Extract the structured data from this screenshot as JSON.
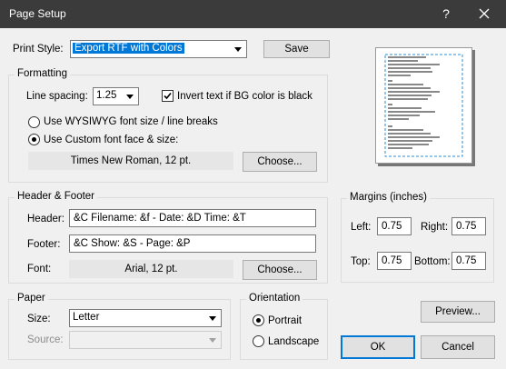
{
  "window": {
    "title": "Page Setup",
    "help_glyph": "?"
  },
  "print_style": {
    "label": "Print Style:",
    "value": "Export RTF with Colors",
    "save_label": "Save"
  },
  "formatting": {
    "legend": "Formatting",
    "line_spacing_label": "Line spacing:",
    "line_spacing_value": "1.25",
    "invert_label": "Invert text if BG color is black",
    "invert_checked": true,
    "wysiwyg_label": "Use WYSIWYG font size / line breaks",
    "custom_font_label": "Use Custom font face & size:",
    "font_value": "Times New Roman, 12 pt.",
    "choose_label": "Choose..."
  },
  "header_footer": {
    "legend": "Header & Footer",
    "header_label": "Header:",
    "header_value": "&C Filename: &f - Date: &D Time: &T",
    "footer_label": "Footer:",
    "footer_value": "&C Show: &S - Page: &P",
    "font_label": "Font:",
    "font_value": "Arial, 12 pt.",
    "choose_label": "Choose..."
  },
  "margins": {
    "legend": "Margins (inches)",
    "left_label": "Left:",
    "left_value": "0.75",
    "right_label": "Right:",
    "right_value": "0.75",
    "top_label": "Top:",
    "top_value": "0.75",
    "bottom_label": "Bottom:",
    "bottom_value": "0.75"
  },
  "paper": {
    "legend": "Paper",
    "size_label": "Size:",
    "size_value": "Letter",
    "source_label": "Source:",
    "source_value": ""
  },
  "orientation": {
    "legend": "Orientation",
    "portrait_label": "Portrait",
    "landscape_label": "Landscape",
    "selected": "Portrait"
  },
  "buttons": {
    "preview": "Preview...",
    "ok": "OK",
    "cancel": "Cancel"
  },
  "colors": {
    "titlebar": "#3b3b3b",
    "selection": "#0078d7",
    "preview_margin": "#2f8fd0"
  },
  "icons": {
    "close": "close-icon",
    "help": "help-icon",
    "dropdown": "chevron-down-icon"
  }
}
